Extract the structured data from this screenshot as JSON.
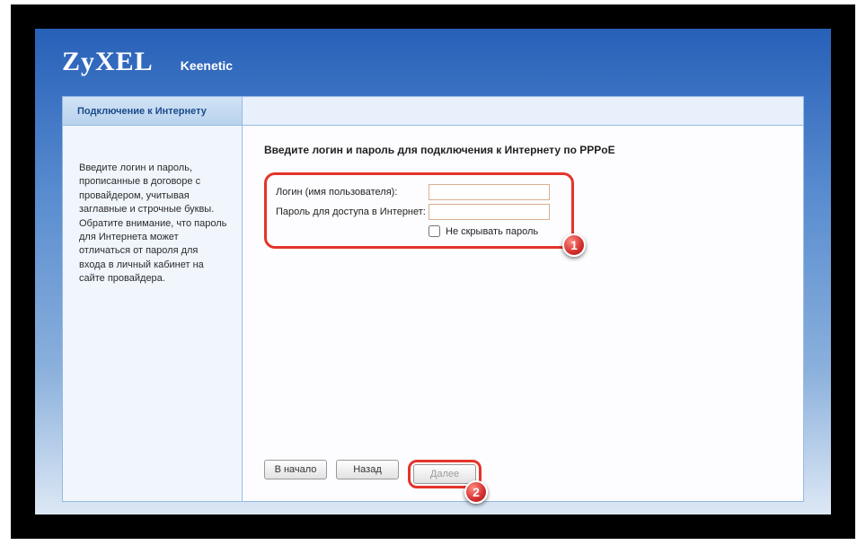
{
  "header": {
    "brand": "ZyXEL",
    "product": "Keenetic"
  },
  "sidebar": {
    "tab_label": "Подключение к Интернету",
    "help_text": "Введите логин и пароль, прописанные в договоре с провайдером, учитывая заглавные и строчные буквы. Обратите внимание, что пароль для Интернета может отличаться от пароля для входа в личный кабинет на сайте провайдера."
  },
  "main": {
    "title": "Введите логин и пароль для подключения к Интернету по PPPoE",
    "login_label": "Логин (имя пользователя):",
    "password_label": "Пароль для доступа в Интернет:",
    "login_value": "",
    "password_value": "",
    "show_password_label": "Не скрывать пароль"
  },
  "buttons": {
    "home": "В начало",
    "back": "Назад",
    "next": "Далее"
  },
  "markers": {
    "one": "1",
    "two": "2"
  }
}
